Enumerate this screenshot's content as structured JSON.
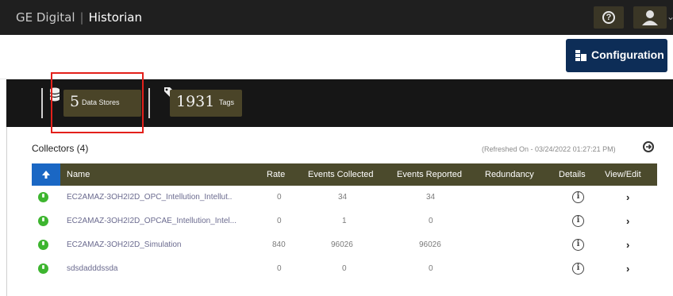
{
  "header": {
    "brand": "GE Digital",
    "separator": "|",
    "app_title": "Historian",
    "help_icon": "question-circle-icon",
    "user_icon": "user-icon"
  },
  "toolbar": {
    "config_label": "Configuration",
    "config_icon": "configuration-icon"
  },
  "stats": {
    "data_stores_count": "5",
    "data_stores_label": "Data Stores",
    "tags_count": "1931",
    "tags_label": "Tags"
  },
  "collectors": {
    "title": "Collectors (4)",
    "refreshed": "(Refreshed On - 03/24/2022 01:27:21 PM)",
    "columns": [
      "Name",
      "Rate",
      "Events Collected",
      "Events Reported",
      "Redundancy",
      "Details",
      "View/Edit"
    ],
    "rows": [
      {
        "name": "EC2AMAZ-3OH2I2D_OPC_Intellution_Intellut..",
        "rate": "0",
        "events_collected": "34",
        "events_reported": "34",
        "redundancy": ""
      },
      {
        "name": "EC2AMAZ-3OH2I2D_OPCAE_Intellution_Intel...",
        "rate": "0",
        "events_collected": "1",
        "events_reported": "0",
        "redundancy": ""
      },
      {
        "name": "EC2AMAZ-3OH2I2D_Simulation",
        "rate": "840",
        "events_collected": "96026",
        "events_reported": "96026",
        "redundancy": ""
      },
      {
        "name": "sdsdadddssda",
        "rate": "0",
        "events_collected": "0",
        "events_reported": "0",
        "redundancy": ""
      }
    ]
  },
  "colors": {
    "topbar": "#1f1f1f",
    "config_button": "#0d2d57",
    "grid_header": "#4b4a2c",
    "sort_cell": "#1a67c4",
    "status_running": "#3db52f",
    "highlight": "#e3201b"
  }
}
